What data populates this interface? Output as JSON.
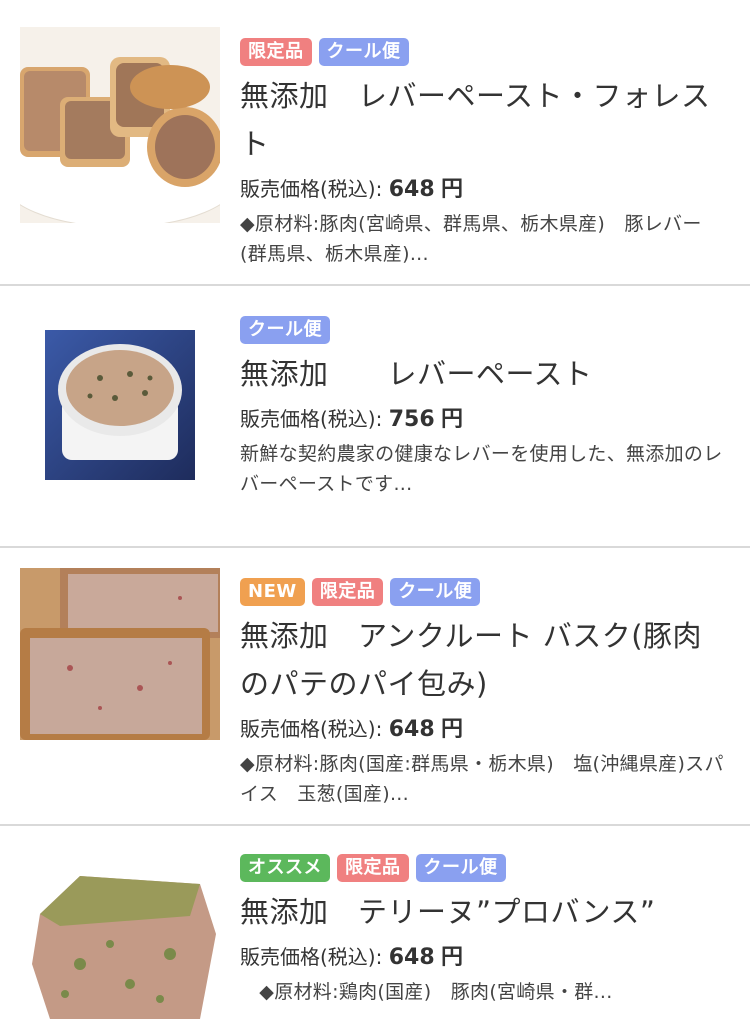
{
  "badge_colors": {
    "NEW": "#f0a050",
    "限定品": "#f08080",
    "クール便": "#8aa0f0",
    "オススメ": "#5cb85c"
  },
  "price_label": "販売価格(税込):",
  "currency": "円",
  "products": [
    {
      "image": "liver-paste-on-bread",
      "badges": [
        "限定品",
        "クール便"
      ],
      "title": "無添加　レバーペースト・フォレスト",
      "price": "648",
      "description": "◆原材料:豚肉(宮崎県、群馬県、栃木県産)　豚レバー(群馬県、栃木県産)..."
    },
    {
      "image": "liver-paste-in-ramekin",
      "badges": [
        "クール便"
      ],
      "title": "無添加　　レバーペースト",
      "price": "756",
      "description": "新鮮な契約農家の健康なレバーを使用した、無添加のレバーペーストです..."
    },
    {
      "image": "pork-pate-in-pastry",
      "badges": [
        "NEW",
        "限定品",
        "クール便"
      ],
      "title": "無添加　アンクルート バスク(豚肉のパテのパイ包み)",
      "price": "648",
      "description": "◆原材料:豚肉(国産:群馬県・栃木県)　塩(沖縄県産)スパイス　玉葱(国産)..."
    },
    {
      "image": "terrine-provence",
      "badges": [
        "オススメ",
        "限定品",
        "クール便"
      ],
      "title": "無添加　テリーヌ”プロバンス”",
      "price": "648",
      "description": "　◆原材料:鶏肉(国産)　豚肉(宮崎県・群..."
    }
  ]
}
